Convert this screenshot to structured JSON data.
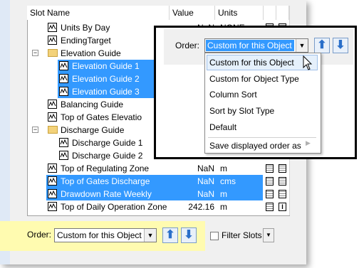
{
  "columns": {
    "name": "Slot Name",
    "value": "Value",
    "units": "Units"
  },
  "rows": [
    {
      "name": "Units By Day",
      "value": "NaN",
      "units": "NONE",
      "type": "slot",
      "level": 1,
      "selected": false
    },
    {
      "name": "EndingTarget",
      "value": "",
      "units": "",
      "type": "slot",
      "level": 1,
      "selected": false
    },
    {
      "name": "Elevation Guide",
      "value": "",
      "units": "",
      "type": "folder",
      "level": 0,
      "selected": false
    },
    {
      "name": "Elevation Guide 1",
      "value": "",
      "units": "",
      "type": "slot",
      "level": 2,
      "selected": true
    },
    {
      "name": "Elevation Guide 2",
      "value": "",
      "units": "",
      "type": "slot",
      "level": 2,
      "selected": true
    },
    {
      "name": "Elevation Guide 3",
      "value": "",
      "units": "",
      "type": "slot",
      "level": 2,
      "selected": true
    },
    {
      "name": "Balancing Guide",
      "value": "",
      "units": "",
      "type": "slot",
      "level": 1,
      "selected": false
    },
    {
      "name": "Top of Gates Elevatio",
      "value": "",
      "units": "",
      "type": "slot",
      "level": 1,
      "selected": false
    },
    {
      "name": "Discharge Guide",
      "value": "",
      "units": "",
      "type": "folder",
      "level": 0,
      "selected": false
    },
    {
      "name": "Discharge Guide 1",
      "value": "",
      "units": "",
      "type": "slot",
      "level": 2,
      "selected": false
    },
    {
      "name": "Discharge Guide 2",
      "value": "",
      "units": "",
      "type": "slot",
      "level": 2,
      "selected": false
    },
    {
      "name": "Top of Regulating Zone",
      "value": "NaN",
      "units": "m",
      "type": "slot",
      "level": 1,
      "selected": false
    },
    {
      "name": "Top of Gates Discharge",
      "value": "NaN",
      "units": "cms",
      "type": "slot",
      "level": 1,
      "selected": true
    },
    {
      "name": "Drawdown Rate Weekly",
      "value": "NaN",
      "units": "m",
      "type": "slot",
      "level": 1,
      "selected": true
    },
    {
      "name": "Top of Daily Operation Zone",
      "value": "242.16",
      "units": "m",
      "type": "slot",
      "level": 1,
      "selected": false
    }
  ],
  "bottom_bar": {
    "order_label": "Order:",
    "order_value": "Custom for this Object",
    "filter_label": "Filter Slots"
  },
  "callout": {
    "order_label": "Order:",
    "order_value": "Custom for this Object",
    "menu_items": [
      "Custom for this Object",
      "Custom for Object Type",
      "Column Sort",
      "Sort by Slot Type",
      "Default",
      "Save displayed order as"
    ]
  },
  "colors": {
    "selection": "#3399ff",
    "highlight_band": "#fffbb0",
    "arrow_blue": "#2a6fc9"
  }
}
